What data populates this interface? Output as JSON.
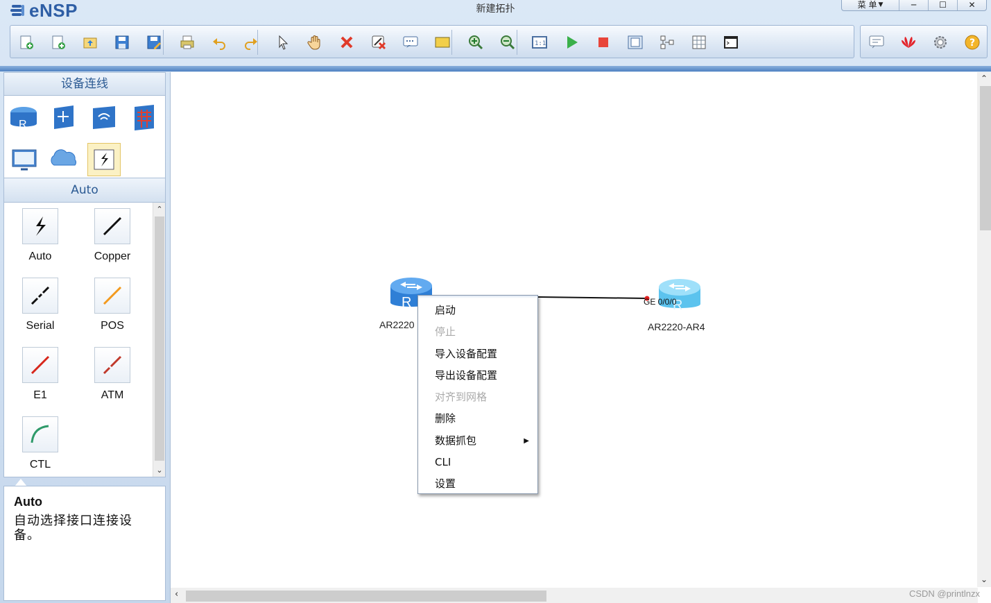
{
  "app": {
    "brand": "eNSP",
    "window_title": "新建拓扑"
  },
  "window_controls": {
    "menu_label": "菜 单",
    "minimize": "─",
    "maximize": "☐",
    "close": "✕"
  },
  "toolbar": {
    "icons": [
      "new-topology-icon",
      "new-blank-icon",
      "open-icon",
      "save-icon",
      "save-as-icon",
      "print-icon",
      "undo-icon",
      "redo-icon",
      "select-icon",
      "pan-hand-icon",
      "delete-icon",
      "delete-all-links-icon",
      "text-note-icon",
      "rectangle-icon",
      "zoom-in-icon",
      "zoom-out-icon",
      "fit-view-icon",
      "start-devices-icon",
      "stop-devices-icon",
      "capture-icon",
      "topology-icon",
      "grid-icon",
      "console-icon"
    ],
    "right_icons": [
      "chat-icon",
      "huawei-logo-icon",
      "settings-gear-icon",
      "help-icon"
    ]
  },
  "left_panel": {
    "category_title": "设备连线",
    "categories": [
      "router-icon",
      "switch-icon",
      "wlan-icon",
      "firewall-icon",
      "pc-icon",
      "cloud-icon",
      "connection-icon"
    ],
    "selected_category": "Auto",
    "links": [
      {
        "label": "Auto",
        "color": "#111111",
        "icon": "auto-link-icon"
      },
      {
        "label": "Copper",
        "color": "#111111",
        "icon": "copper-link-icon"
      },
      {
        "label": "Serial",
        "color": "#111111",
        "icon": "serial-link-icon"
      },
      {
        "label": "POS",
        "color": "#f39a1e",
        "icon": "pos-link-icon"
      },
      {
        "label": "E1",
        "color": "#d7261b",
        "icon": "e1-link-icon"
      },
      {
        "label": "ATM",
        "color": "#c0392b",
        "icon": "atm-link-icon"
      },
      {
        "label": "CTL",
        "color": "#2e9a6a",
        "icon": "ctl-link-icon"
      }
    ],
    "description": {
      "title": "Auto",
      "text": "自动选择接口连接设备。"
    }
  },
  "canvas": {
    "devices": [
      {
        "name": "AR2220"
      },
      {
        "name": "AR2220-AR4"
      }
    ],
    "link_port": "GE 0/0/0"
  },
  "context_menu": {
    "items": [
      {
        "label": "启动",
        "enabled": true
      },
      {
        "label": "停止",
        "enabled": false
      },
      {
        "label": "导入设备配置",
        "enabled": true
      },
      {
        "label": "导出设备配置",
        "enabled": true
      },
      {
        "label": "对齐到网格",
        "enabled": false
      },
      {
        "label": "删除",
        "enabled": true
      },
      {
        "label": "数据抓包",
        "enabled": true,
        "submenu": true
      },
      {
        "label": "CLI",
        "enabled": true
      },
      {
        "label": "设置",
        "enabled": true
      }
    ]
  },
  "watermark": "CSDN @printlnzx"
}
